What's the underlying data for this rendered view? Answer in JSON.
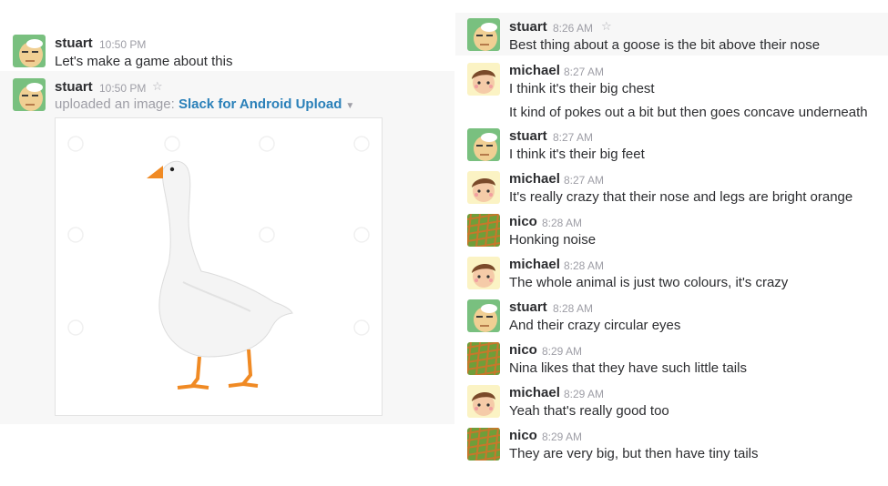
{
  "left_panel": {
    "messages": [
      {
        "user": "stuart",
        "time": "10:50 PM",
        "text": "Let's make a game about this",
        "avatar": "stuart-avatar"
      },
      {
        "user": "stuart",
        "time": "10:50 PM",
        "star": "☆",
        "upload_prefix": "uploaded an image:",
        "upload_title": "Slack for Android Upload",
        "caret": "▼",
        "image": "white-goose-photo",
        "avatar": "stuart-avatar"
      }
    ]
  },
  "right_panel": {
    "messages": [
      {
        "user": "stuart",
        "time": "8:26 AM",
        "star": "☆",
        "text": "Best thing about a goose is the bit above their nose"
      },
      {
        "user": "michael",
        "time": "8:27 AM",
        "text": "I think it's their big chest",
        "text2": "It kind of pokes out a bit but then goes concave underneath"
      },
      {
        "user": "stuart",
        "time": "8:27 AM",
        "text": "I think it's their big feet"
      },
      {
        "user": "michael",
        "time": "8:27 AM",
        "text": "It's really crazy that their nose and legs are bright orange"
      },
      {
        "user": "nico",
        "time": "8:28 AM",
        "text": "Honking noise"
      },
      {
        "user": "michael",
        "time": "8:28 AM",
        "text": "The whole animal is just two colours, it's crazy"
      },
      {
        "user": "stuart",
        "time": "8:28 AM",
        "text": "And their crazy circular eyes"
      },
      {
        "user": "nico",
        "time": "8:29 AM",
        "text": "Nina likes that they have such little tails"
      },
      {
        "user": "michael",
        "time": "8:29 AM",
        "text": "Yeah that's really good too"
      },
      {
        "user": "nico",
        "time": "8:29 AM",
        "text": "They are very big, but then have tiny tails"
      }
    ]
  },
  "colors": {
    "link": "#2a80b9",
    "highlight": "#f7f7f7",
    "timestamp": "#9e9ea6"
  }
}
